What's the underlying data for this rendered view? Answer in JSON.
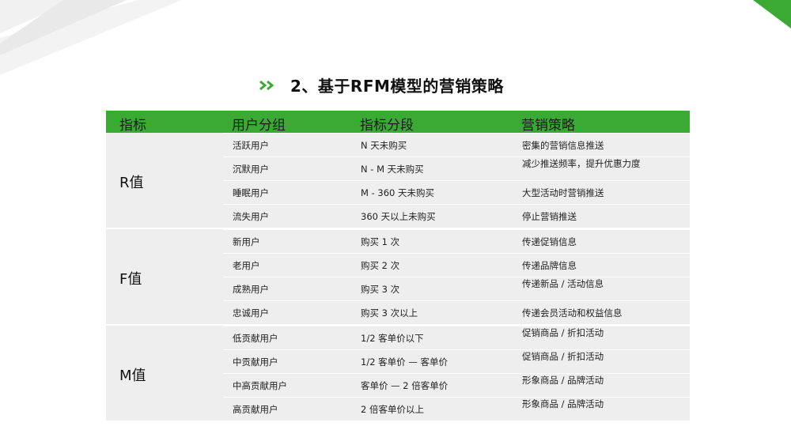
{
  "title": "2、基于RFM模型的营销策略",
  "title_icon": "double-chevron-right-icon",
  "colors": {
    "accent": "#3aaa35",
    "row_bg": "#eeeeee"
  },
  "header": [
    "指标",
    "用户分组",
    "指标分段",
    "营销策略"
  ],
  "groups": [
    {
      "label": "R值",
      "rows": [
        [
          "活跃用户",
          "N 天未购买",
          "密集的营销信息推送"
        ],
        [
          "沉默用户",
          "N - M   天未购买",
          "减少推送频率，提升优惠力度"
        ],
        [
          "睡眠用户",
          "M - 360   天未购买",
          "大型活动时营销推送"
        ],
        [
          "流失用户",
          "360 天以上未购买",
          "停止营销推送"
        ]
      ]
    },
    {
      "label": "F值",
      "rows": [
        [
          "新用户",
          "购买  1 次",
          "传递促销信息"
        ],
        [
          "老用户",
          "购买  2 次",
          "传递品牌信息"
        ],
        [
          "成熟用户",
          "购买  3 次",
          "传递新品    / 活动信息"
        ],
        [
          "忠诚用户",
          "购买  3 次以上",
          "传递会员活动和权益信息"
        ]
      ]
    },
    {
      "label": "M值",
      "rows": [
        [
          "低贡献用户",
          "1/2  客单价以下",
          "促销商品    / 折扣活动"
        ],
        [
          "中贡献用户",
          "1/2  客单价    — 客单价",
          "促销商品    / 折扣活动"
        ],
        [
          "中高贡献用户",
          "客单价    — 2 倍客单价",
          "形象商品    / 品牌活动"
        ],
        [
          "高贡献用户",
          "2 倍客单价以上",
          "形象商品    / 品牌活动"
        ]
      ]
    }
  ]
}
